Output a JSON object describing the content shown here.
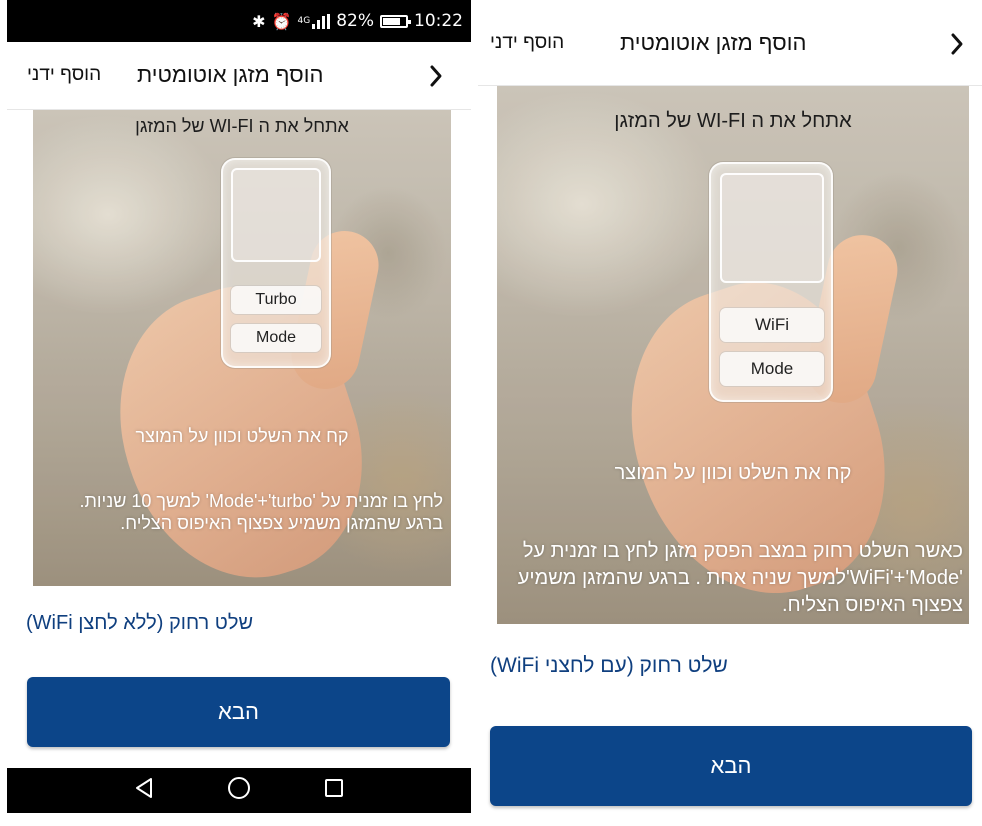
{
  "status_bar": {
    "bluetooth": "bluetooth-icon",
    "alarm": "alarm-icon",
    "network_type": "4G",
    "battery": "82%",
    "time": "10:22"
  },
  "left": {
    "header": {
      "title": "הוסף מזגן אוטומטית",
      "manual": "הוסף ידני"
    },
    "hero": {
      "title": "אתחל את ה WI-FI של המזגן",
      "buttons": [
        "Turbo",
        "Mode"
      ],
      "subtitle": "קח את השלט וכוון על המוצר",
      "instructions": "לחץ בו זמנית על 'Mode'+'turbo' למשך 10 שניות. ברגע שהמזגן משמיע צפצוף האיפוס הצליח."
    },
    "link": "שלט רחוק (ללא לחצן WiFi)",
    "next_button": "הבא"
  },
  "right": {
    "header": {
      "title": "הוסף מזגן אוטומטית",
      "manual": "הוסף ידני"
    },
    "hero": {
      "title": "אתחל את ה WI-FI של המזגן",
      "buttons": [
        "WiFi",
        "Mode"
      ],
      "subtitle": "קח את השלט וכוון על המוצר",
      "instructions": "כאשר השלט רחוק במצב הפסק מזגן לחץ בו זמנית על 'WiFi'+'Mode'למשך שניה אחת . ברגע שהמזגן משמיע צפצוף האיפוס הצליח."
    },
    "link": "שלט רחוק (עם לחצני WiFi)",
    "next_button": "הבא"
  },
  "colors": {
    "primary": "#0c4589",
    "link": "#0f3f7f"
  }
}
